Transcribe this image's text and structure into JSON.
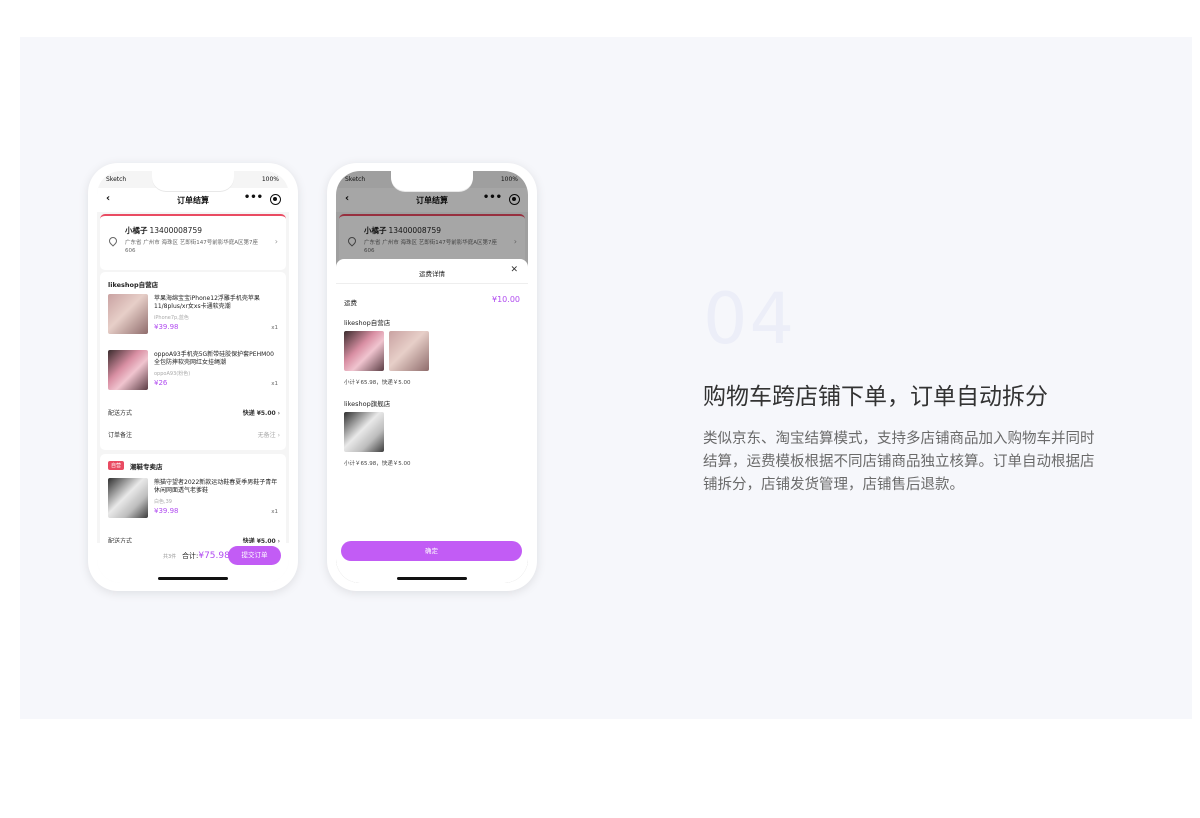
{
  "section": {
    "number": "04",
    "heading": "购物车跨店铺下单，订单自动拆分",
    "description": "类似京东、淘宝结算模式，支持多店铺商品加入购物车并同时结算，运费模板根据不同店铺商品独立核算。订单自动根据店铺拆分，店铺发货管理，店铺售后退款。"
  },
  "status_bar": {
    "carrier": "Sketch",
    "battery": "100%"
  },
  "phone1": {
    "title": "订单结算",
    "address": {
      "name": "小橘子",
      "phone": "13400008759",
      "detail": "广东省 广州市 海珠区 艺即街147号前影华庭A区第7座606"
    },
    "shop1": {
      "name": "likeshop自营店",
      "items": [
        {
          "title": "苹果海绵宝宝iPhone12浮雕手机壳苹果11/8plus/xr女xs卡通软壳潮",
          "spec": "iPhone7p,蓝色",
          "price": "¥39.98",
          "qty": "x1"
        },
        {
          "title": "oppoA93手机壳5G新带硅胶保护套PEHM00全包防摔软壳网红女挂绳潮",
          "spec": "oppoA93(粉色)",
          "price": "¥26",
          "qty": "x1"
        }
      ],
      "delivery_label": "配送方式",
      "delivery_value": "快递",
      "delivery_fee": "¥5.00",
      "note_label": "订单备注",
      "note_value": "无备注"
    },
    "shop2": {
      "tag": "自营",
      "name": "潮鞋专卖店",
      "item": {
        "title": "熊猫守望者2022新款运动鞋春夏季男鞋子青年休闲网面透气老爹鞋",
        "spec": "白色,39",
        "price": "¥39.98",
        "qty": "x1"
      },
      "delivery_label": "配送方式",
      "delivery_value": "快递",
      "delivery_fee": "¥5.00"
    },
    "bottom": {
      "count": "共3件",
      "total_label": "合计:",
      "total_value": "¥75.98",
      "submit": "提交订单"
    }
  },
  "phone2": {
    "title": "订单结算",
    "sheet_title": "运费详情",
    "fee_label": "运费",
    "fee_value": "¥10.00",
    "shop1_name": "likeshop自营店",
    "shop1_subtotal": "小计￥65.98，快递￥5.00",
    "shop2_name": "likeshop旗舰店",
    "shop2_subtotal": "小计￥65.98，快递￥5.00",
    "confirm": "确定"
  }
}
